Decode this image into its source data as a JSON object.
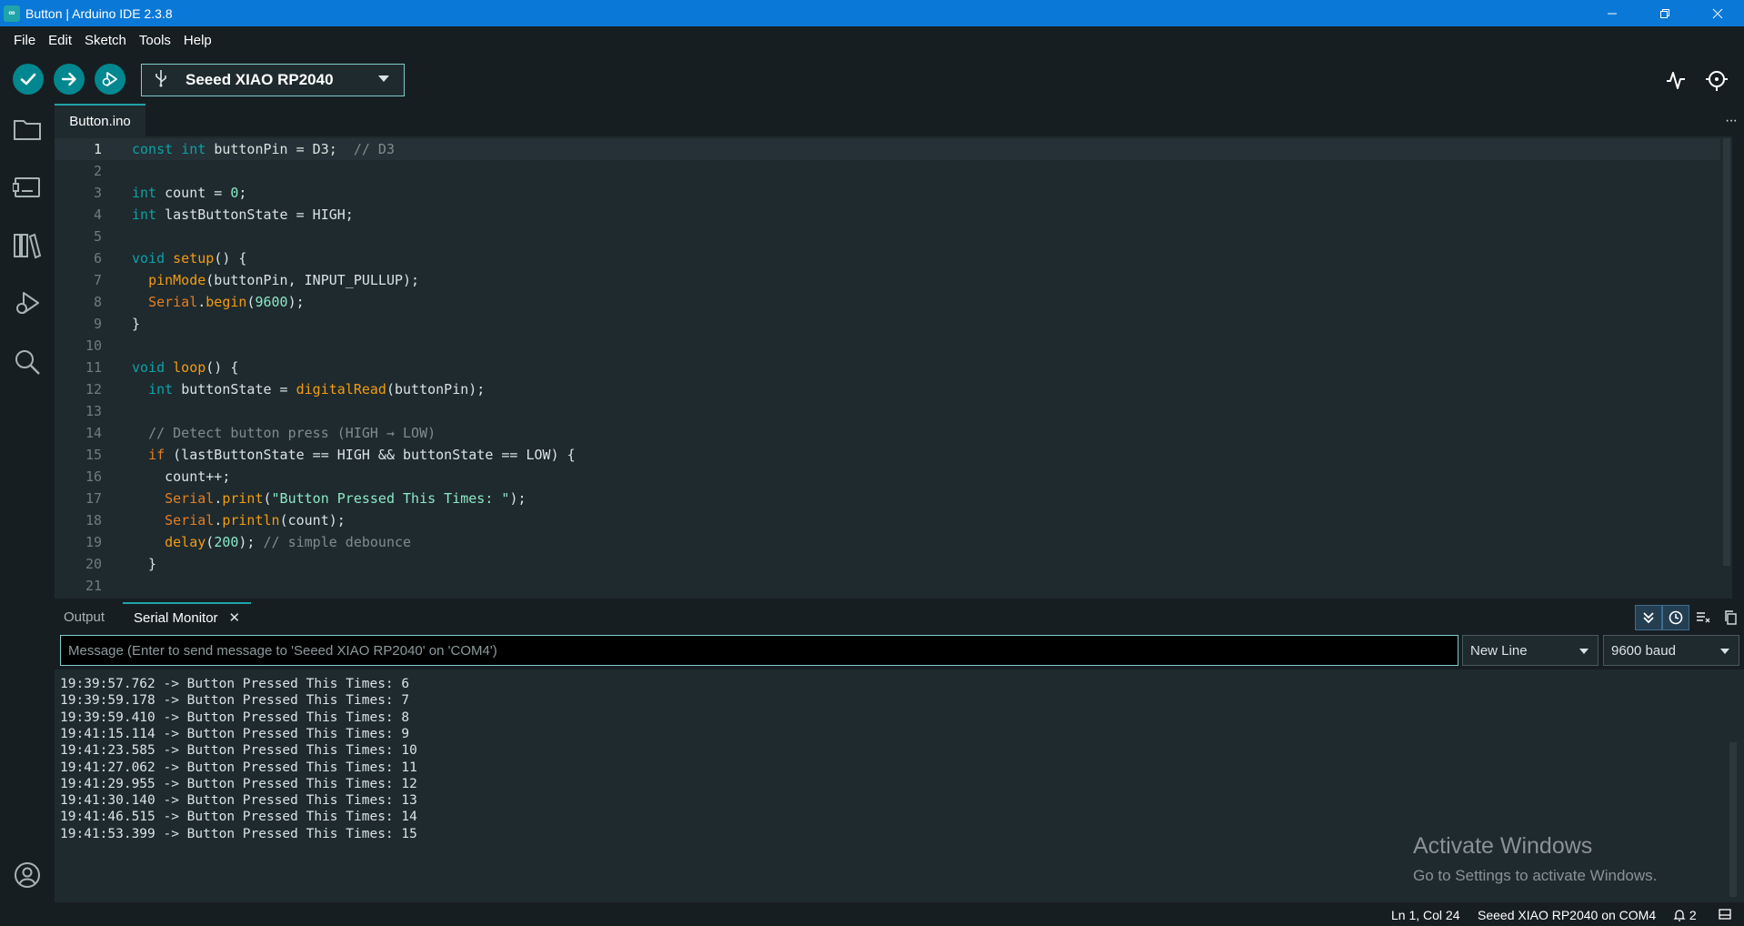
{
  "window": {
    "title": "Button | Arduino IDE 2.3.8",
    "app_icon_glyph": "∞"
  },
  "menu": [
    "File",
    "Edit",
    "Sketch",
    "Tools",
    "Help"
  ],
  "toolbar": {
    "board": "Seeed XIAO RP2040"
  },
  "editor": {
    "tab": "Button.ino",
    "lines": [
      {
        "n": "1",
        "tokens": [
          {
            "t": "const ",
            "c": "kw"
          },
          {
            "t": "int ",
            "c": "kw"
          },
          {
            "t": "buttonPin = D3;  ",
            "c": ""
          },
          {
            "t": "// D3",
            "c": "cm"
          }
        ]
      },
      {
        "n": "2",
        "tokens": []
      },
      {
        "n": "3",
        "tokens": [
          {
            "t": "int ",
            "c": "kw"
          },
          {
            "t": "count = ",
            "c": ""
          },
          {
            "t": "0",
            "c": "num"
          },
          {
            "t": ";",
            "c": ""
          }
        ]
      },
      {
        "n": "4",
        "tokens": [
          {
            "t": "int ",
            "c": "kw"
          },
          {
            "t": "lastButtonState = HIGH;",
            "c": ""
          }
        ]
      },
      {
        "n": "5",
        "tokens": []
      },
      {
        "n": "6",
        "tokens": [
          {
            "t": "void ",
            "c": "kw"
          },
          {
            "t": "setup",
            "c": "fn"
          },
          {
            "t": "() {",
            "c": ""
          }
        ]
      },
      {
        "n": "7",
        "tokens": [
          {
            "t": "  ",
            "c": ""
          },
          {
            "t": "pinMode",
            "c": "fn"
          },
          {
            "t": "(buttonPin, INPUT_PULLUP);",
            "c": ""
          }
        ]
      },
      {
        "n": "8",
        "tokens": [
          {
            "t": "  ",
            "c": ""
          },
          {
            "t": "Serial",
            "c": "cls"
          },
          {
            "t": ".",
            "c": ""
          },
          {
            "t": "begin",
            "c": "fn"
          },
          {
            "t": "(",
            "c": ""
          },
          {
            "t": "9600",
            "c": "num"
          },
          {
            "t": ");",
            "c": ""
          }
        ]
      },
      {
        "n": "9",
        "tokens": [
          {
            "t": "}",
            "c": ""
          }
        ]
      },
      {
        "n": "10",
        "tokens": []
      },
      {
        "n": "11",
        "tokens": [
          {
            "t": "void ",
            "c": "kw"
          },
          {
            "t": "loop",
            "c": "fn"
          },
          {
            "t": "() {",
            "c": ""
          }
        ]
      },
      {
        "n": "12",
        "tokens": [
          {
            "t": "  ",
            "c": ""
          },
          {
            "t": "int ",
            "c": "kw"
          },
          {
            "t": "buttonState = ",
            "c": ""
          },
          {
            "t": "digitalRead",
            "c": "fn"
          },
          {
            "t": "(buttonPin);",
            "c": ""
          }
        ]
      },
      {
        "n": "13",
        "tokens": []
      },
      {
        "n": "14",
        "tokens": [
          {
            "t": "  ",
            "c": ""
          },
          {
            "t": "// Detect button press (HIGH → LOW)",
            "c": "cm"
          }
        ]
      },
      {
        "n": "15",
        "tokens": [
          {
            "t": "  ",
            "c": ""
          },
          {
            "t": "if ",
            "c": "cls"
          },
          {
            "t": "(lastButtonState == HIGH && buttonState == LOW) {",
            "c": ""
          }
        ]
      },
      {
        "n": "16",
        "tokens": [
          {
            "t": "    count++;",
            "c": ""
          }
        ]
      },
      {
        "n": "17",
        "tokens": [
          {
            "t": "    ",
            "c": ""
          },
          {
            "t": "Serial",
            "c": "cls"
          },
          {
            "t": ".",
            "c": ""
          },
          {
            "t": "print",
            "c": "fn"
          },
          {
            "t": "(",
            "c": ""
          },
          {
            "t": "\"Button Pressed This Times: \"",
            "c": "str"
          },
          {
            "t": ");",
            "c": ""
          }
        ]
      },
      {
        "n": "18",
        "tokens": [
          {
            "t": "    ",
            "c": ""
          },
          {
            "t": "Serial",
            "c": "cls"
          },
          {
            "t": ".",
            "c": ""
          },
          {
            "t": "println",
            "c": "fn"
          },
          {
            "t": "(count);",
            "c": ""
          }
        ]
      },
      {
        "n": "19",
        "tokens": [
          {
            "t": "    ",
            "c": ""
          },
          {
            "t": "delay",
            "c": "fn"
          },
          {
            "t": "(",
            "c": ""
          },
          {
            "t": "200",
            "c": "num"
          },
          {
            "t": "); ",
            "c": ""
          },
          {
            "t": "// simple debounce",
            "c": "cm"
          }
        ]
      },
      {
        "n": "20",
        "tokens": [
          {
            "t": "  }",
            "c": ""
          }
        ]
      },
      {
        "n": "21",
        "tokens": []
      }
    ]
  },
  "panel": {
    "output_tab": "Output",
    "serial_tab": "Serial Monitor",
    "close_glyph": "✕",
    "message_placeholder": "Message (Enter to send message to 'Seeed XIAO RP2040' on 'COM4')",
    "line_ending": "New Line",
    "baud": "9600 baud",
    "serial_lines": [
      "19:39:57.762 -> Button Pressed This Times: 6",
      "19:39:59.178 -> Button Pressed This Times: 7",
      "19:39:59.410 -> Button Pressed This Times: 8",
      "19:41:15.114 -> Button Pressed This Times: 9",
      "19:41:23.585 -> Button Pressed This Times: 10",
      "19:41:27.062 -> Button Pressed This Times: 11",
      "19:41:29.955 -> Button Pressed This Times: 12",
      "19:41:30.140 -> Button Pressed This Times: 13",
      "19:41:46.515 -> Button Pressed This Times: 14",
      "19:41:53.399 -> Button Pressed This Times: 15"
    ]
  },
  "watermark": {
    "line1": "Activate Windows",
    "line2": "Go to Settings to activate Windows."
  },
  "status": {
    "position": "Ln 1, Col 24",
    "board_port": "Seeed XIAO RP2040 on COM4",
    "notifications": "2"
  },
  "colors": {
    "accent": "#00878f",
    "titlebar": "#0a78d7",
    "editor_bg": "#1f2a2e",
    "chrome_bg": "#171e21"
  }
}
